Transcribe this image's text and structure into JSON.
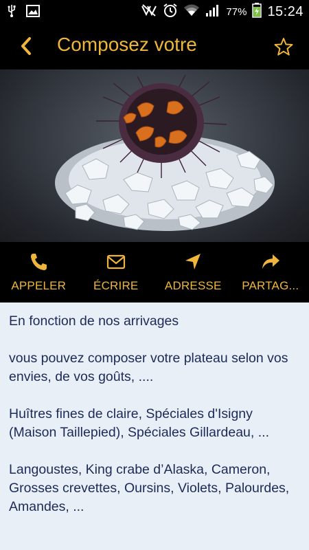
{
  "status_bar": {
    "battery_percent": "77%",
    "time": "15:24",
    "icons": [
      "usb-icon",
      "image-icon",
      "mute-icon",
      "alarm-icon",
      "wifi-icon",
      "signal-icon",
      "battery-charging-icon"
    ]
  },
  "action_bar": {
    "title": "Composez votre",
    "back_icon": "chevron-left-icon",
    "favorite_icon": "star-outline-icon"
  },
  "hero": {
    "icon": "sea-urchin-on-ice-photo"
  },
  "actions": [
    {
      "label": "APPELER",
      "icon": "phone-icon"
    },
    {
      "label": "ÉCRIRE",
      "icon": "envelope-icon"
    },
    {
      "label": "ADRESSE",
      "icon": "navigation-arrow-icon"
    },
    {
      "label": "PARTAG...",
      "icon": "share-icon"
    }
  ],
  "content": {
    "paragraphs": [
      "En fonction de nos arrivages",
      "vous pouvez composer votre plateau selon vos envies, de vos goûts, ....",
      "Huîtres fines de claire, Spéciales d'Isigny (Maison Taillepied), Spéciales Gillardeau, ...",
      "Langoustes, King crabe d’Alaska, Cameron, Grosses crevettes, Oursins, Violets, Palourdes, Amandes, ..."
    ]
  },
  "colors": {
    "accent": "#f0b63c",
    "bar_background": "#000000",
    "content_background": "#e9eff7",
    "content_text": "#1c2a57"
  }
}
